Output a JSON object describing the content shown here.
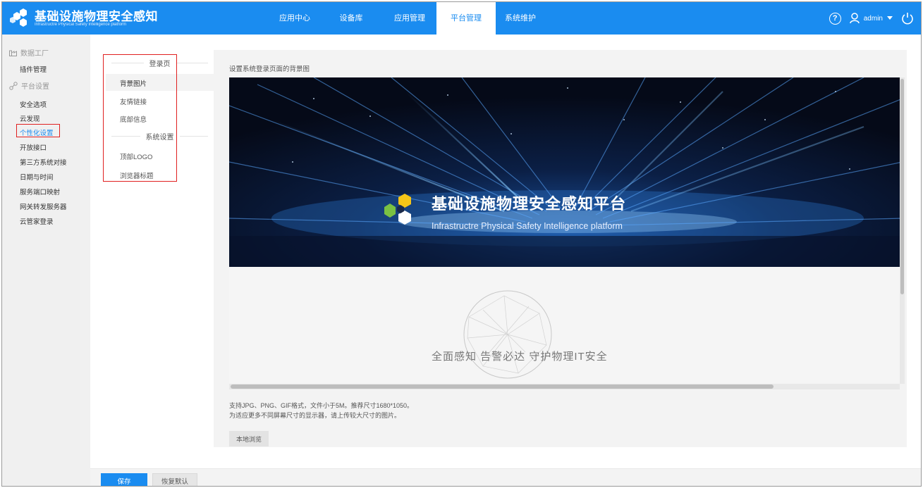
{
  "app": {
    "title": "基础设施物理安全感知",
    "subtitle": "Infrastructre Physical Safety Intelligence platform"
  },
  "nav": {
    "items": [
      {
        "label": "应用中心",
        "active": false
      },
      {
        "label": "设备库",
        "active": false
      },
      {
        "label": "应用管理",
        "active": false
      },
      {
        "label": "平台管理",
        "active": true
      },
      {
        "label": "系统维护",
        "active": false
      }
    ]
  },
  "user": {
    "name": "admin",
    "help_icon": "help-icon",
    "user_icon": "user-icon",
    "power_icon": "power-icon"
  },
  "sidebar": {
    "groups": [
      {
        "label": "数据工厂",
        "icon": "factory-icon",
        "items": [
          "插件管理"
        ]
      },
      {
        "label": "平台设置",
        "icon": "settings-icon",
        "items": [
          "安全选项",
          "云发现",
          "个性化设置",
          "开放接口",
          "第三方系统对接",
          "日期与时间",
          "服务端口映射",
          "网关转发服务器",
          "云管家登录"
        ]
      }
    ],
    "active_item": "个性化设置"
  },
  "subnav": {
    "sections": [
      {
        "title": "登录页",
        "items": [
          "背景图片",
          "友情链接",
          "底部信息"
        ]
      },
      {
        "title": "系统设置",
        "items": [
          "顶部LOGO",
          "浏览器标题"
        ]
      }
    ],
    "active_item": "背景图片"
  },
  "content": {
    "label": "设置系统登录页面的背景图",
    "preview": {
      "title": "基础设施物理安全感知平台",
      "subtitle": "Infrastructre Physical Safety Intelligence platform",
      "tagline": "全面感知  告警必达  守护物理IT安全"
    },
    "hint_line1": "支持JPG、PNG、GIF格式，文件小于5M。推荐尺寸1680*1050。",
    "hint_line2": "为适应更多不同屏幕尺寸的显示器，请上传较大尺寸的图片。",
    "browse_label": "本地浏览"
  },
  "footer": {
    "save_label": "保存",
    "reset_label": "恢复默认"
  },
  "colors": {
    "accent": "#1a8cf0",
    "highlight_box": "#e02020",
    "logo_green": "#7ac143",
    "logo_yellow": "#f5c518"
  }
}
